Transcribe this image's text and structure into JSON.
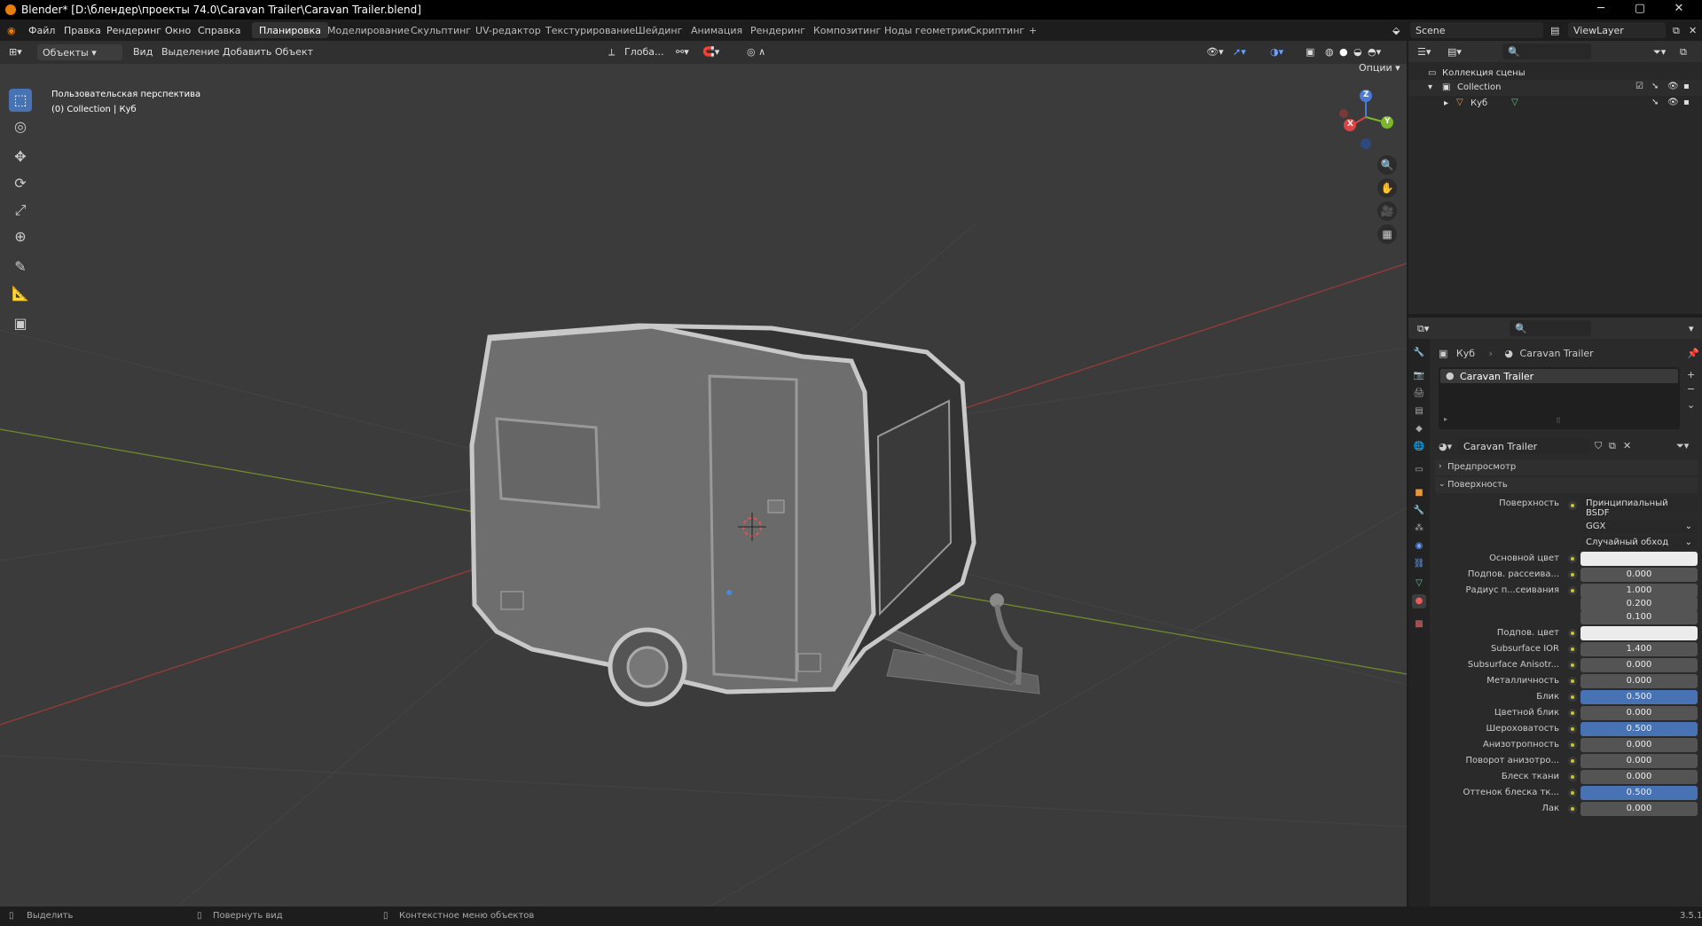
{
  "titlebar": {
    "title": "Blender* [D:\\блендер\\проекты 74.0\\Caravan Trailer\\Caravan Trailer.blend]",
    "min": "─",
    "max": "▢",
    "close": "✕"
  },
  "menu": {
    "file": "Файл",
    "edit": "Правка",
    "render": "Рендеринг",
    "window": "Окно",
    "help": "Справка"
  },
  "workspaces": [
    "Планировка",
    "Моделирование",
    "Скульптинг",
    "UV-редактор",
    "Текстурирование",
    "Шейдинг",
    "Анимация",
    "Рендеринг",
    "Композитинг",
    "Ноды геометрии",
    "Скриптинг"
  ],
  "workspace_add": "+",
  "scene": {
    "name": "Scene",
    "viewlayer": "ViewLayer"
  },
  "viewport_header": {
    "mode": "Объекты",
    "view": "Вид",
    "select": "Выделение",
    "add": "Добавить",
    "object": "Объект",
    "orientation": "Глоба...",
    "options": "Опции"
  },
  "viewport_info": {
    "perspective": "Пользовательская перспектива",
    "collection": "(0) Collection | Куб"
  },
  "gizmo": {
    "x": "X",
    "y": "Y",
    "z": "Z"
  },
  "outliner": {
    "scene_collection": "Коллекция сцены",
    "collection": "Collection",
    "object": "Куб"
  },
  "properties": {
    "breadcrumb_object": "Куб",
    "breadcrumb_material": "Caravan Trailer",
    "slot_name": "Caravan Trailer",
    "material_name": "Caravan Trailer",
    "preview": "Предпросмотр",
    "surface_panel": "Поверхность",
    "surface_label": "Поверхность",
    "surface_shader": "Принципиальный BSDF",
    "distribution": "GGX",
    "subsurface_method": "Случайный обход",
    "rows": [
      {
        "label": "Основной цвет",
        "value": "",
        "kind": "color"
      },
      {
        "label": "Подпов. рассеива...",
        "value": "0.000",
        "kind": "num"
      },
      {
        "label": "Радиус п...сеивания",
        "value": "1.000",
        "kind": "num"
      },
      {
        "label": "",
        "value": "0.200",
        "kind": "num"
      },
      {
        "label": "",
        "value": "0.100",
        "kind": "num"
      },
      {
        "label": "Подпов. цвет",
        "value": "",
        "kind": "color"
      },
      {
        "label": "Subsurface IOR",
        "value": "1.400",
        "kind": "num"
      },
      {
        "label": "Subsurface Anisotr...",
        "value": "0.000",
        "kind": "num"
      },
      {
        "label": "Металличность",
        "value": "0.000",
        "kind": "num"
      },
      {
        "label": "Блик",
        "value": "0.500",
        "kind": "blue"
      },
      {
        "label": "Цветной блик",
        "value": "0.000",
        "kind": "num"
      },
      {
        "label": "Шероховатость",
        "value": "0.500",
        "kind": "blue"
      },
      {
        "label": "Анизотропность",
        "value": "0.000",
        "kind": "num"
      },
      {
        "label": "Поворот анизотро...",
        "value": "0.000",
        "kind": "num"
      },
      {
        "label": "Блеск ткани",
        "value": "0.000",
        "kind": "num"
      },
      {
        "label": "Оттенок блеска тк...",
        "value": "0.500",
        "kind": "blue"
      },
      {
        "label": "Лак",
        "value": "0.000",
        "kind": "num"
      }
    ]
  },
  "status": {
    "select": "Выделить",
    "rotate": "Повернуть вид",
    "context": "Контекстное меню объектов",
    "version": "3.5.1"
  },
  "colors": {
    "accent": "#4772b3",
    "viewport": "#3b3b3b",
    "header": "#303030"
  }
}
